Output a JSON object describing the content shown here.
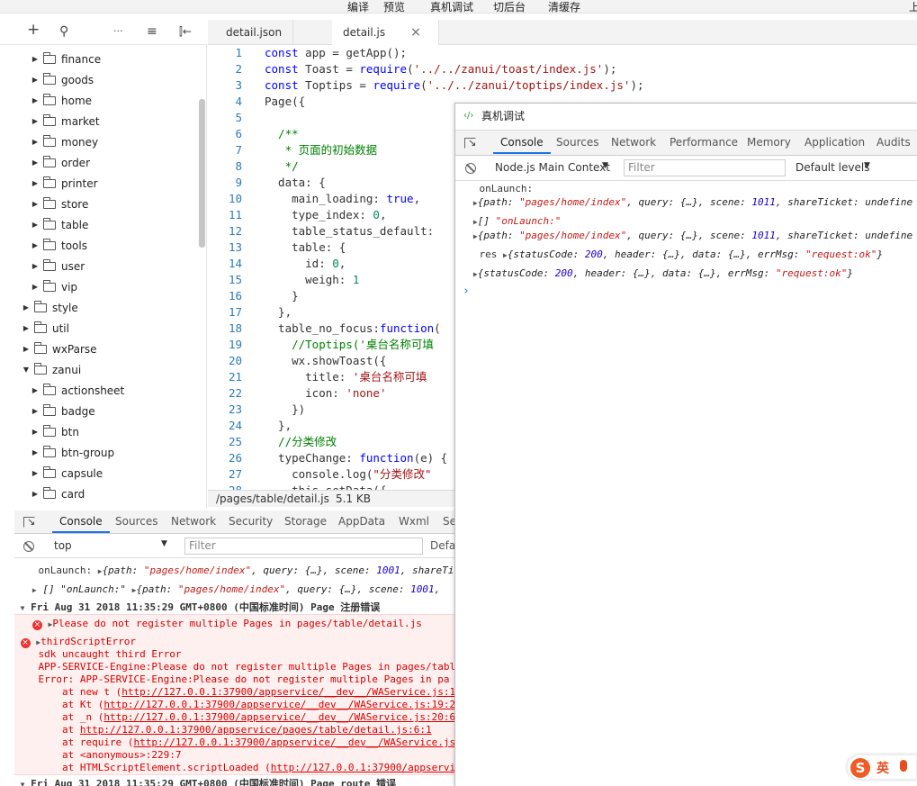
{
  "menu": [
    "编译",
    "预览",
    "真机调试",
    "切后台",
    "清缓存",
    "上"
  ],
  "tree_toolbar": {
    "add": "+",
    "search": "⚲",
    "more": "···",
    "sort": "≡",
    "collapse": "⫿←"
  },
  "tree": [
    {
      "label": "finance",
      "expanded": false
    },
    {
      "label": "goods",
      "expanded": false
    },
    {
      "label": "home",
      "expanded": false
    },
    {
      "label": "market",
      "expanded": false
    },
    {
      "label": "money",
      "expanded": false
    },
    {
      "label": "order",
      "expanded": false
    },
    {
      "label": "printer",
      "expanded": false
    },
    {
      "label": "store",
      "expanded": false
    },
    {
      "label": "table",
      "expanded": false
    },
    {
      "label": "tools",
      "expanded": false
    },
    {
      "label": "user",
      "expanded": false
    },
    {
      "label": "vip",
      "expanded": false
    },
    {
      "label": "style",
      "expanded": false
    },
    {
      "label": "util",
      "expanded": false
    },
    {
      "label": "wxParse",
      "expanded": false
    },
    {
      "label": "zanui",
      "expanded": true
    },
    {
      "label": "actionsheet",
      "expanded": false
    },
    {
      "label": "badge",
      "expanded": false
    },
    {
      "label": "btn",
      "expanded": false
    },
    {
      "label": "btn-group",
      "expanded": false
    },
    {
      "label": "capsule",
      "expanded": false
    },
    {
      "label": "card",
      "expanded": false
    }
  ],
  "editor_tabs": [
    {
      "label": "detail.json",
      "active": false
    },
    {
      "label": "detail.js",
      "active": true,
      "close": "×"
    }
  ],
  "code_lines": [
    {
      "n": "1",
      "text": "const app = getApp();"
    },
    {
      "n": "2",
      "text": "const Toast = require('../../zanui/toast/index.js');"
    },
    {
      "n": "3",
      "text": "const Toptips = require('../../zanui/toptips/index.js');"
    },
    {
      "n": "4",
      "text": "Page({"
    },
    {
      "n": "5",
      "text": ""
    },
    {
      "n": "6",
      "text": "  /**"
    },
    {
      "n": "7",
      "text": "   * 页面的初始数据"
    },
    {
      "n": "8",
      "text": "   */"
    },
    {
      "n": "9",
      "text": "  data: {"
    },
    {
      "n": "10",
      "text": "    main_loading: true,"
    },
    {
      "n": "11",
      "text": "    type_index: 0,"
    },
    {
      "n": "12",
      "text": "    table_status_default:"
    },
    {
      "n": "13",
      "text": "    table: {"
    },
    {
      "n": "14",
      "text": "      id: 0,"
    },
    {
      "n": "15",
      "text": "      weigh: 1"
    },
    {
      "n": "16",
      "text": "    }"
    },
    {
      "n": "17",
      "text": "  },"
    },
    {
      "n": "18",
      "text": "  table_no_focus:function("
    },
    {
      "n": "19",
      "text": "    //Toptips('桌台名称可填"
    },
    {
      "n": "20",
      "text": "    wx.showToast({"
    },
    {
      "n": "21",
      "text": "      title: '桌台名称可填"
    },
    {
      "n": "22",
      "text": "      icon: 'none'"
    },
    {
      "n": "23",
      "text": "    })"
    },
    {
      "n": "24",
      "text": "  },"
    },
    {
      "n": "25",
      "text": "  //分类修改"
    },
    {
      "n": "26",
      "text": "  typeChange: function(e) {"
    },
    {
      "n": "27",
      "text": "    console.log(\"分类修改\""
    },
    {
      "n": "28",
      "text": "    this.setData({"
    }
  ],
  "status_bar": {
    "path": "/pages/table/detail.js",
    "size": "5.1 KB"
  },
  "bottom_devtools": {
    "tabs": [
      "Console",
      "Sources",
      "Network",
      "Security",
      "Storage",
      "AppData",
      "Wxml",
      "Se"
    ],
    "active_tab": "Console",
    "context": "top",
    "filter_placeholder": "Filter",
    "levels": "Defa"
  },
  "bottom_console": [
    {
      "type": "log",
      "label": "onLaunch:",
      "obj": "{path: \"pages/home/index\", query: {…}, scene: 1001, shareTi"
    },
    {
      "type": "log",
      "label": "[] \"onLaunch:\"",
      "obj": "{path: \"pages/home/index\", query: {…}, scene: 1001,"
    },
    {
      "type": "group",
      "text": "Fri Aug 31 2018 11:35:29 GMT+0800 (中国标准时间) Page 注册错误"
    },
    {
      "type": "error",
      "text": "Please do not register multiple Pages in pages/table/detail.js"
    },
    {
      "type": "error",
      "text": "thirdScriptError"
    },
    {
      "type": "errtext",
      "text": "sdk uncaught third Error"
    },
    {
      "type": "errtext",
      "text": "APP-SERVICE-Engine:Please do not register multiple Pages in pages/tabl"
    },
    {
      "type": "errtext",
      "text": "Error: APP-SERVICE-Engine:Please do not register multiple Pages in pa"
    },
    {
      "type": "stack",
      "prefix": "    at new t (",
      "url": "http://127.0.0.1:37900/appservice/__dev__/WAService.js:19"
    },
    {
      "type": "stack",
      "prefix": "    at Kt (",
      "url": "http://127.0.0.1:37900/appservice/__dev__/WAService.js:19:27"
    },
    {
      "type": "stack",
      "prefix": "    at _n (",
      "url": "http://127.0.0.1:37900/appservice/__dev__/WAService.js:20:62"
    },
    {
      "type": "stack",
      "prefix": "    at ",
      "url": "http://127.0.0.1:37900/appservice/pages/table/detail.js:6:1"
    },
    {
      "type": "stack",
      "prefix": "    at require (",
      "url": "http://127.0.0.1:37900/appservice/__dev__/WAService.js"
    },
    {
      "type": "errtext",
      "text": "    at <anonymous>:229:7"
    },
    {
      "type": "stack",
      "prefix": "    at HTMLScriptElement.scriptLoaded (",
      "url": "http://127.0.0.1:37900/appservic"
    },
    {
      "type": "group",
      "text": "Fri Aug 31 2018 11:35:29 GMT+0800 (中国标准时间) Page route 错误"
    }
  ],
  "remote": {
    "title": "真机调试",
    "title_icon": "‹/›",
    "tabs": [
      "Console",
      "Sources",
      "Network",
      "Performance",
      "Memory",
      "Application",
      "Audits"
    ],
    "active_tab": "Console",
    "context": "Node.js Main Context",
    "filter_placeholder": "Filter",
    "levels": "Default levels",
    "console": [
      {
        "kind": "label",
        "text": "onLaunch:"
      },
      {
        "kind": "obj",
        "text": "{path: \"pages/home/index\", query: {…}, scene: 1011, shareTicket: undefine"
      },
      {
        "kind": "obj",
        "text": "[] \"onLaunch:\""
      },
      {
        "kind": "obj",
        "text": "{path: \"pages/home/index\", query: {…}, scene: 1011, shareTicket: undefine"
      },
      {
        "kind": "res",
        "label": "res",
        "text": "{statusCode: 200, header: {…}, data: {…}, errMsg: \"request:ok\"}"
      },
      {
        "kind": "obj",
        "text": "{statusCode: 200, header: {…}, data: {…}, errMsg: \"request:ok\"}"
      }
    ],
    "prompt": "›"
  },
  "ime": {
    "logo": "S",
    "mode": "英"
  },
  "colors": {
    "accent": "#1a73e8",
    "error_bg": "#fff0f0",
    "error_text": "#d80000",
    "keyword": "#0000ff",
    "string": "#a31515",
    "comment": "#008000",
    "number": "#098658",
    "line_number": "#2b7bb9"
  }
}
